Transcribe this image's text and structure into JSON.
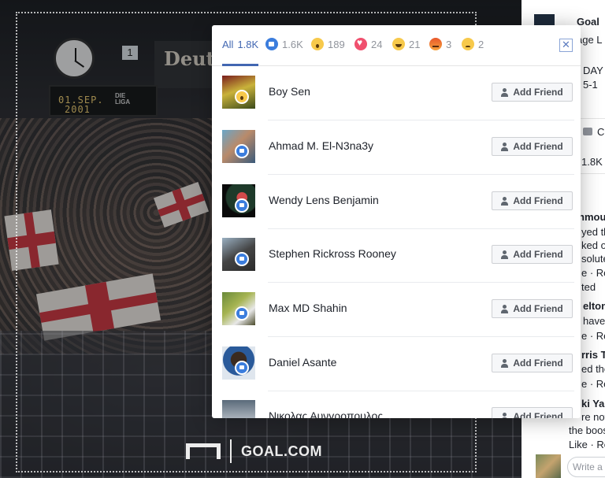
{
  "background": {
    "scoreboard_number": "1",
    "board_date_line1": "01.SEP.",
    "board_date_line2": "2001",
    "board_liga": "DIE LIGA",
    "banner_text": "Deut",
    "logo_text": "GOAL.COM"
  },
  "right_column": {
    "page_name": "Goal",
    "page_sub": "age L",
    "day_text": "DAY",
    "score_text": "5-1",
    "comment_label": "C",
    "count_label": "1.8K",
    "comments": [
      {
        "name": "hmou",
        "lines": [
          "yed th",
          "ked o",
          "solute"
        ],
        "actions": "e · Re",
        "time": "ted"
      },
      {
        "name": "elton",
        "lines": [
          "have"
        ],
        "actions": "e · Re"
      },
      {
        "name": "rris T",
        "lines": [
          "ed the"
        ],
        "actions": "e · Re"
      },
      {
        "name": "ki Ya",
        "lines": [
          "re not",
          "the boos"
        ],
        "actions": "Like · Re"
      }
    ],
    "write_placeholder": "Write a"
  },
  "modal": {
    "tabs": [
      {
        "label": "All",
        "count": "1.8K",
        "icon": "none"
      },
      {
        "label": "",
        "count": "1.6K",
        "icon": "like"
      },
      {
        "label": "",
        "count": "189",
        "icon": "wow"
      },
      {
        "label": "",
        "count": "24",
        "icon": "love"
      },
      {
        "label": "",
        "count": "21",
        "icon": "haha"
      },
      {
        "label": "",
        "count": "3",
        "icon": "angry"
      },
      {
        "label": "",
        "count": "2",
        "icon": "sad"
      }
    ],
    "close_label": "✕",
    "add_friend_label": "Add Friend",
    "people": [
      {
        "name": "Boy Sen",
        "reaction": "wow"
      },
      {
        "name": "Ahmad M. El-N3na3y",
        "reaction": "like"
      },
      {
        "name": "Wendy Lens Benjamin",
        "reaction": "like"
      },
      {
        "name": "Stephen Rickross Rooney",
        "reaction": "like"
      },
      {
        "name": "Max MD Shahin",
        "reaction": "like"
      },
      {
        "name": "Daniel Asante",
        "reaction": "like"
      },
      {
        "name": "Νικολας Αυνγροπουλος",
        "reaction": "like"
      }
    ]
  }
}
